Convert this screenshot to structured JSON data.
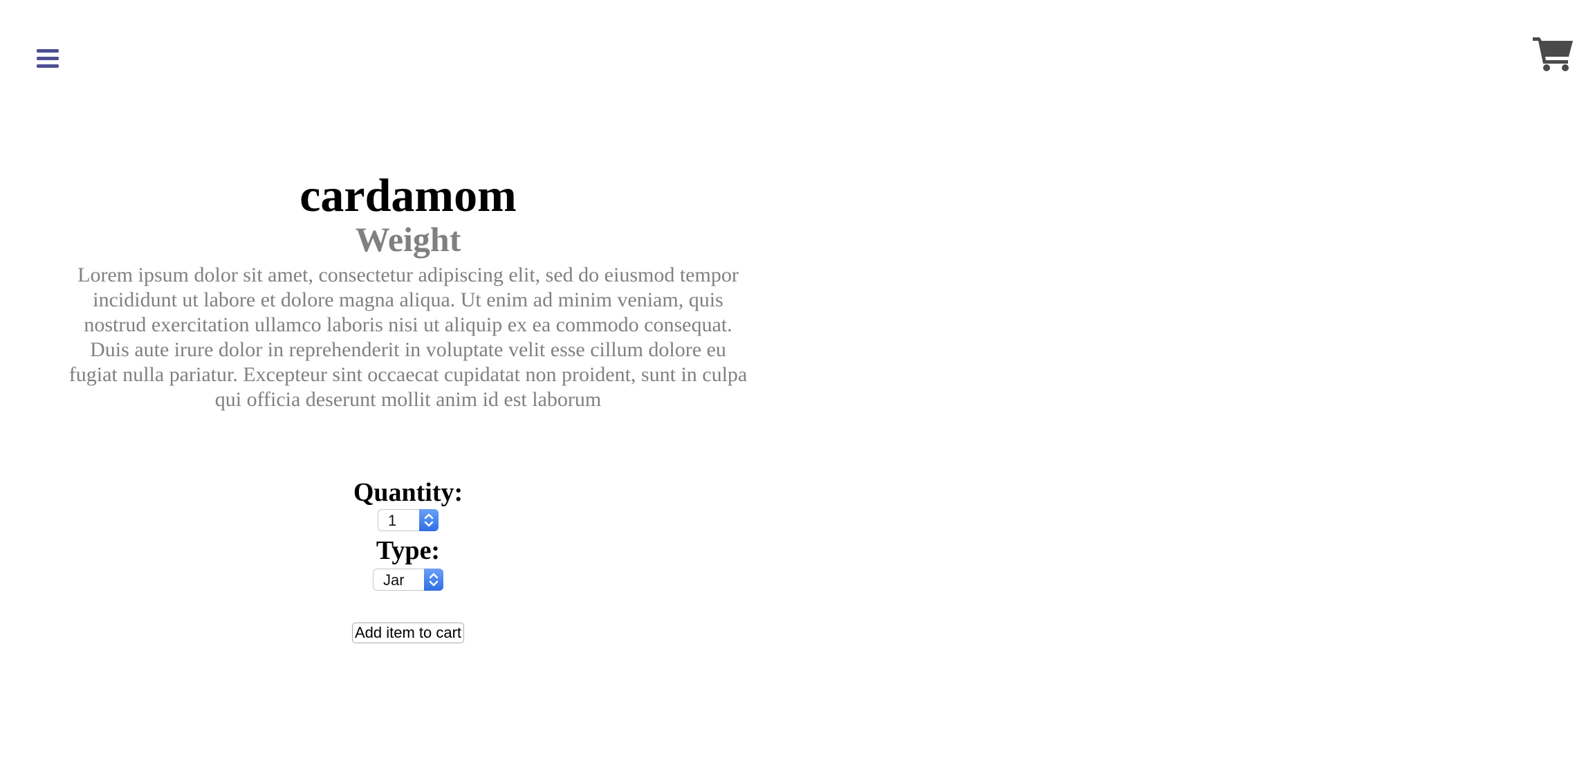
{
  "header": {
    "menu_icon": "hamburger-menu-icon",
    "cart_icon": "shopping-cart-icon",
    "colors": {
      "menu": "#4d4f94",
      "cart": "#4a4a4a"
    }
  },
  "product": {
    "title": "cardamom",
    "subtitle": "Weight",
    "description": "Lorem ipsum dolor sit amet, consectetur adipiscing elit, sed do eiusmod tempor incididunt ut labore et dolore magna aliqua. Ut enim ad minim veniam, quis nostrud exercitation ullamco laboris nisi ut aliquip ex ea commodo consequat. Duis aute irure dolor in reprehenderit in voluptate velit esse cillum dolore eu fugiat nulla pariatur. Excepteur sint occaecat cupidatat non proident, sunt in culpa qui officia deserunt mollit anim id est laborum"
  },
  "options": {
    "quantity_label": "Quantity:",
    "quantity_value": "1",
    "type_label": "Type:",
    "type_value": "Jar"
  },
  "actions": {
    "add_to_cart_label": "Add item to cart"
  }
}
